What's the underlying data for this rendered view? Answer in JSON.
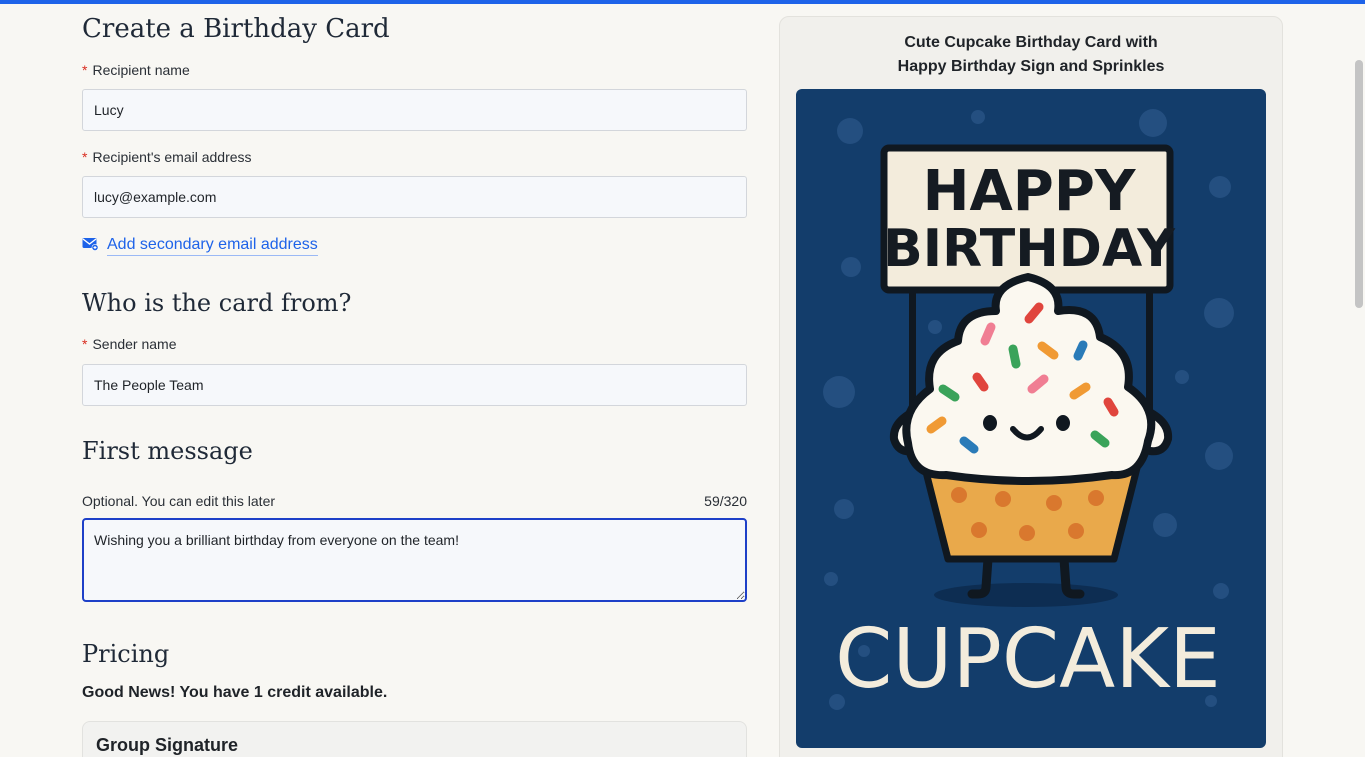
{
  "form": {
    "title": "Create a Birthday Card",
    "recipient_name": {
      "label": "Recipient name",
      "required": "*",
      "value": "Lucy"
    },
    "recipient_email": {
      "label": "Recipient's email address",
      "required": "*",
      "value": "lucy@example.com"
    },
    "secondary_email_link": "Add secondary email address",
    "from_section_title": "Who is the card from?",
    "sender_name": {
      "label": "Sender name",
      "required": "*",
      "value": "The People Team"
    },
    "message_section_title": "First message",
    "message": {
      "hint": "Optional. You can edit this later",
      "counter": "59/320",
      "value": "Wishing you a brilliant birthday from everyone on the team!"
    },
    "pricing_title": "Pricing",
    "credit_notice": "Good News! You have 1 credit available.",
    "group_signature_title": "Group Signature"
  },
  "preview": {
    "title_line1": "Cute Cupcake Birthday Card with",
    "title_line2": "Happy Birthday Sign and Sprinkles",
    "card": {
      "sign_line1": "HAPPY",
      "sign_line2": "BIRTHDAY",
      "bottom_text": "CUPCAKE"
    }
  },
  "colors": {
    "accent": "#1e63e9",
    "required": "#d92d20",
    "card_background": "#133d6b",
    "frosting": "#fbf8f0",
    "cupcake_base": "#e9a94b"
  }
}
